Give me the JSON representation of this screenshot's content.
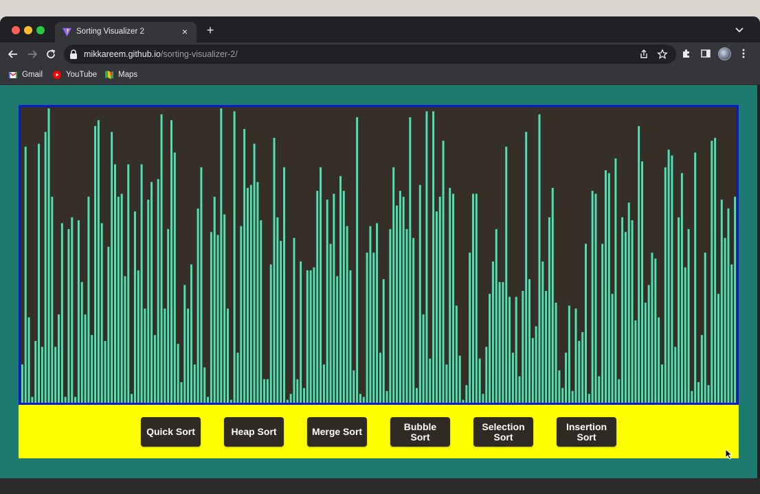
{
  "browser": {
    "tab": {
      "title": "Sorting Visualizer 2",
      "close_label": "×",
      "favicon": "vite-icon"
    },
    "new_tab_label": "+",
    "address": {
      "host": "mikkareem.github.io",
      "path": "/sorting-visualizer-2/"
    },
    "bookmarks": [
      {
        "label": "Gmail",
        "icon": "gmail-icon"
      },
      {
        "label": "YouTube",
        "icon": "youtube-icon"
      },
      {
        "label": "Maps",
        "icon": "maps-icon"
      }
    ]
  },
  "colors": {
    "page_bg": "#1c7a6f",
    "chart_bg": "#362f28",
    "chart_border": "#0a1ac8",
    "bar": "#4fe0b1",
    "controls_bg": "#ffff00",
    "button_bg": "#2f2a23",
    "button_text": "#ffffff"
  },
  "buttons": [
    {
      "label": "Quick Sort"
    },
    {
      "label": "Heap Sort"
    },
    {
      "label": "Merge Sort"
    },
    {
      "label": "Bubble Sort"
    },
    {
      "label": "Selection Sort"
    },
    {
      "label": "Insertion Sort"
    }
  ],
  "array": {
    "max": 100,
    "values": [
      13,
      87,
      29,
      2,
      21,
      88,
      19,
      92,
      100,
      70,
      19,
      30,
      61,
      2,
      59,
      63,
      2,
      62,
      41,
      30,
      70,
      23,
      94,
      96,
      61,
      21,
      53,
      92,
      81,
      70,
      71,
      43,
      81,
      3,
      65,
      45,
      81,
      32,
      69,
      75,
      23,
      76,
      98,
      32,
      59,
      96,
      85,
      20,
      7,
      40,
      32,
      47,
      13,
      66,
      80,
      12,
      2,
      58,
      70,
      57,
      100,
      64,
      32,
      1,
      99,
      17,
      60,
      93,
      73,
      74,
      88,
      75,
      62,
      8,
      8,
      47,
      90,
      63,
      55,
      80,
      1,
      3,
      56,
      8,
      48,
      5,
      45,
      45,
      46,
      72,
      80,
      13,
      69,
      54,
      71,
      43,
      77,
      72,
      60,
      45,
      11,
      97,
      3,
      2,
      51,
      60,
      51,
      61,
      17,
      42,
      4,
      59,
      80,
      67,
      72,
      70,
      59,
      97,
      56,
      5,
      74,
      30,
      99,
      15,
      99,
      65,
      70,
      89,
      13,
      73,
      71,
      33,
      16,
      1,
      6,
      51,
      71,
      71,
      15,
      3,
      19,
      37,
      48,
      59,
      41,
      41,
      87,
      36,
      17,
      36,
      9,
      38,
      92,
      42,
      22,
      26,
      98,
      48,
      38,
      63,
      73,
      34,
      11,
      5,
      17,
      33,
      4,
      32,
      21,
      24,
      54,
      3,
      72,
      71,
      9,
      54,
      79,
      78,
      37,
      83,
      8,
      63,
      58,
      68,
      62,
      28,
      94,
      82,
      34,
      40,
      51,
      49,
      29,
      13,
      80,
      86,
      84,
      19,
      63,
      78,
      46,
      59,
      4,
      85,
      7,
      23,
      51,
      6,
      89,
      90,
      37,
      69,
      56,
      66,
      47,
      70
    ]
  }
}
